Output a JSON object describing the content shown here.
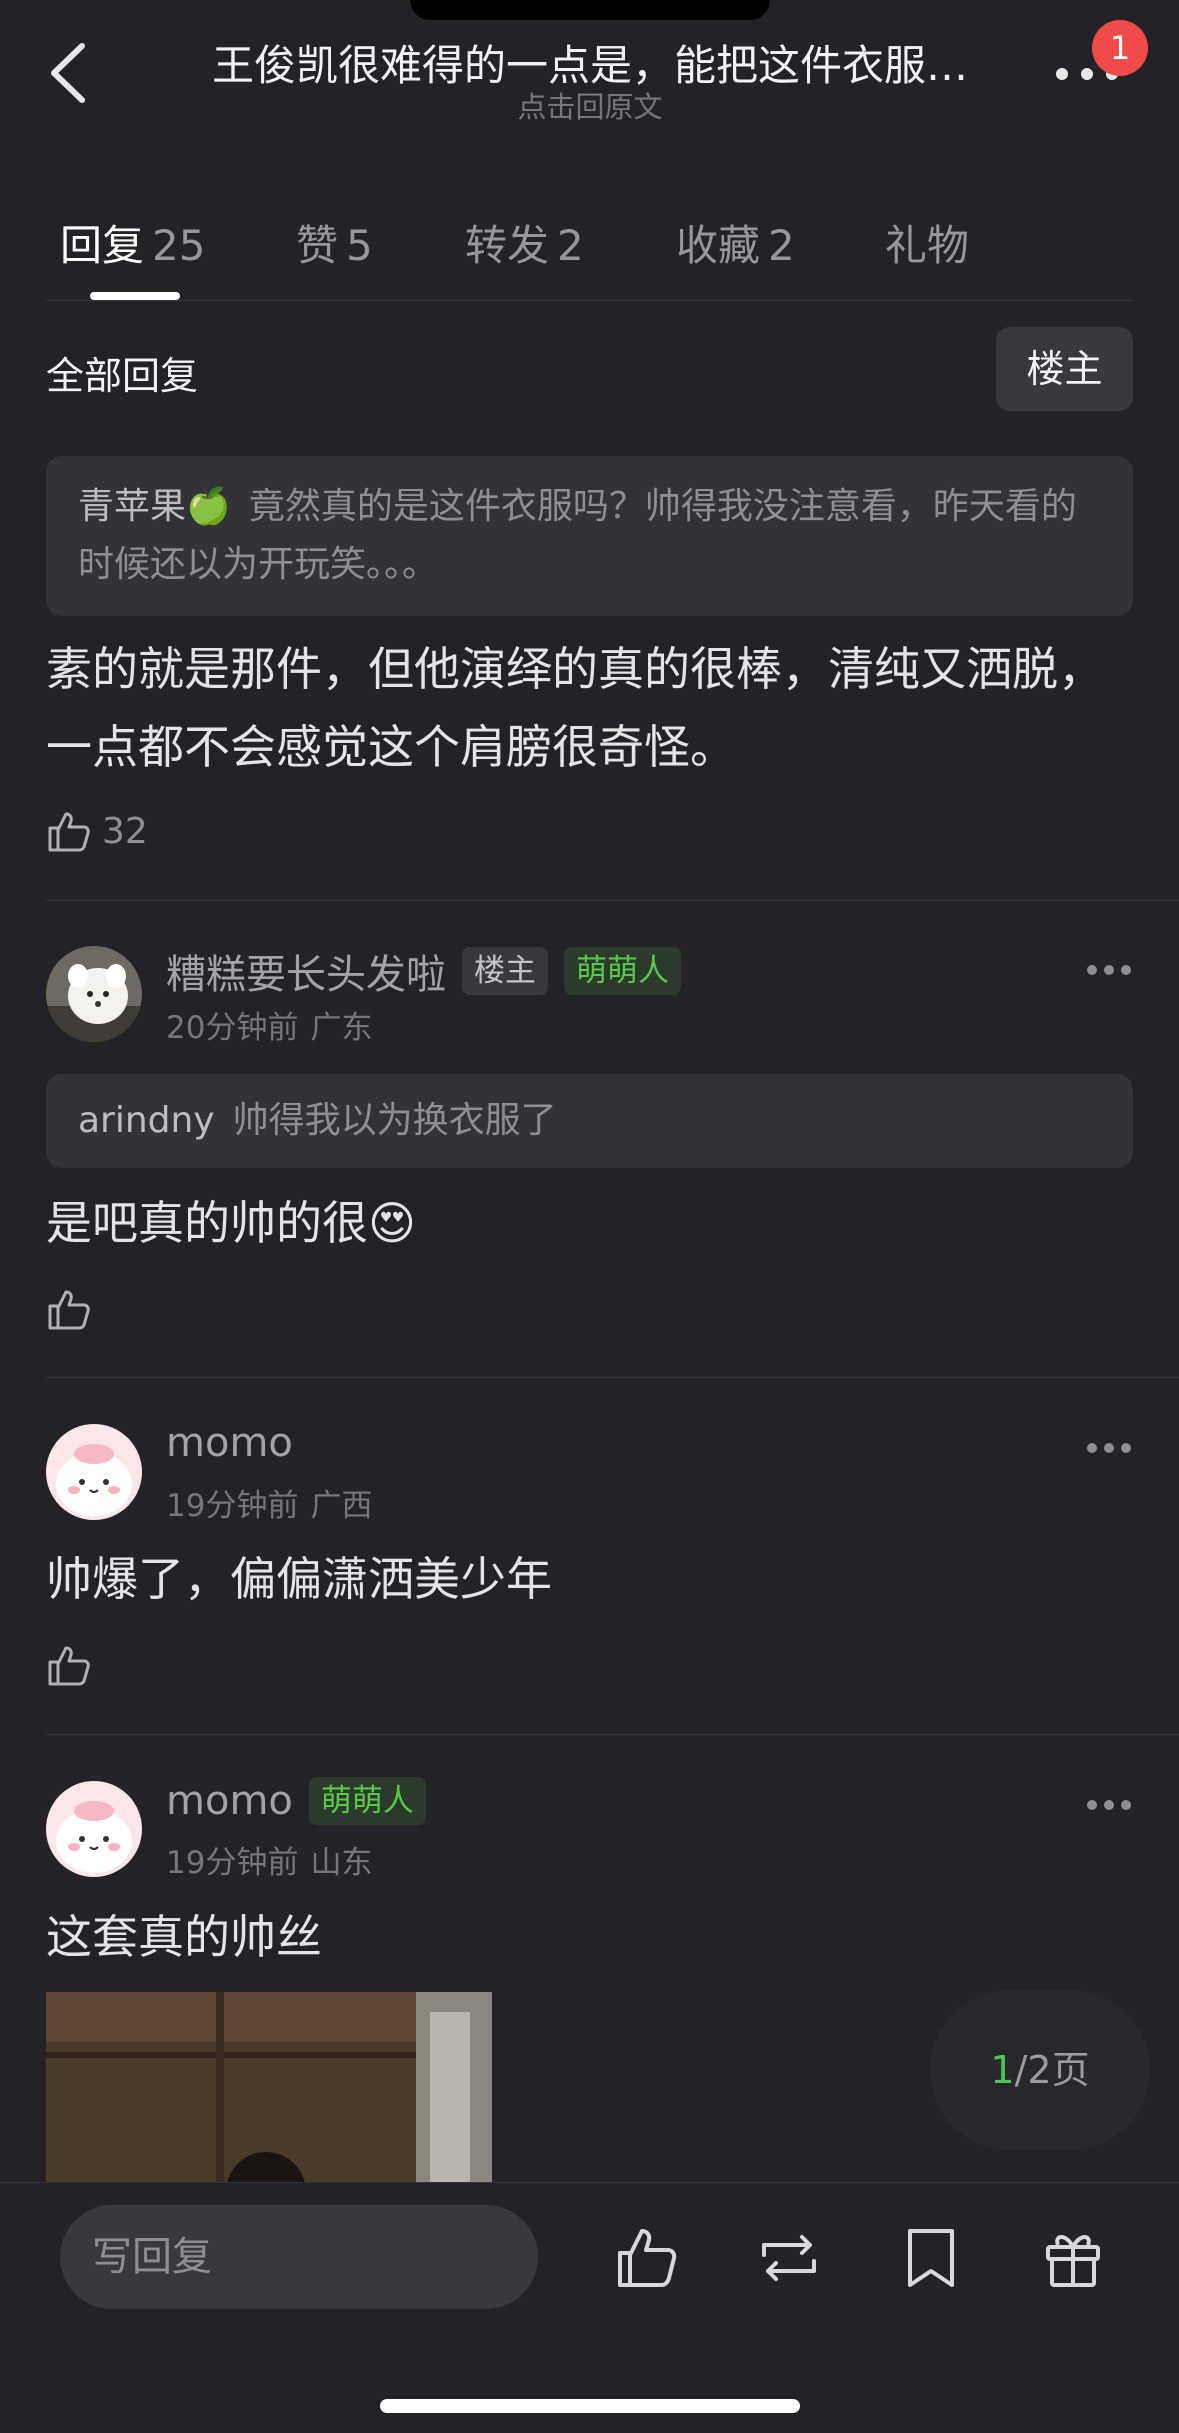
{
  "header": {
    "title": "王俊凯很难得的一点是，能把这件衣服…",
    "subtitle": "点击回原文",
    "badge_count": "1"
  },
  "tabs": [
    {
      "label": "回复",
      "count": "25",
      "active": true
    },
    {
      "label": "赞",
      "count": "5"
    },
    {
      "label": "转发",
      "count": "2"
    },
    {
      "label": "收藏",
      "count": "2"
    },
    {
      "label": "礼物",
      "count": ""
    }
  ],
  "filter": {
    "label": "全部回复",
    "owner_button": "楼主"
  },
  "comments": [
    {
      "quote_name": "青苹果🍏",
      "quote_text": "竟然真的是这件衣服吗？帅得我没注意看，昨天看的时候还以为开玩笑。。。",
      "text": "素的就是那件，但他演绎的真的很棒，清纯又洒脱，一点都不会感觉这个肩膀很奇怪。",
      "likes": "32"
    },
    {
      "name": "糟糕要长头发啦",
      "tags": [
        "楼主",
        "萌萌人"
      ],
      "time": "20分钟前",
      "location": "广东",
      "quote_name": "arindny",
      "quote_text": "帅得我以为换衣服了",
      "text": "是吧真的帅的很😍",
      "likes": ""
    },
    {
      "name": "momo",
      "time": "19分钟前",
      "location": "广西",
      "text": "帅爆了，偏偏潇洒美少年",
      "likes": ""
    },
    {
      "name": "momo",
      "tags": [
        "萌萌人"
      ],
      "time": "19分钟前",
      "location": "山东",
      "text": "这套真的帅丝",
      "likes": ""
    }
  ],
  "pager": {
    "current": "1",
    "total_text": "/2页"
  },
  "bottom_bar": {
    "reply_placeholder": "写回复",
    "icons": [
      "like-icon",
      "repost-icon",
      "bookmark-icon",
      "gift-icon"
    ]
  },
  "colors": {
    "background": "#232327",
    "accent_green": "#4fc25a",
    "badge_red": "#f04a4a"
  }
}
